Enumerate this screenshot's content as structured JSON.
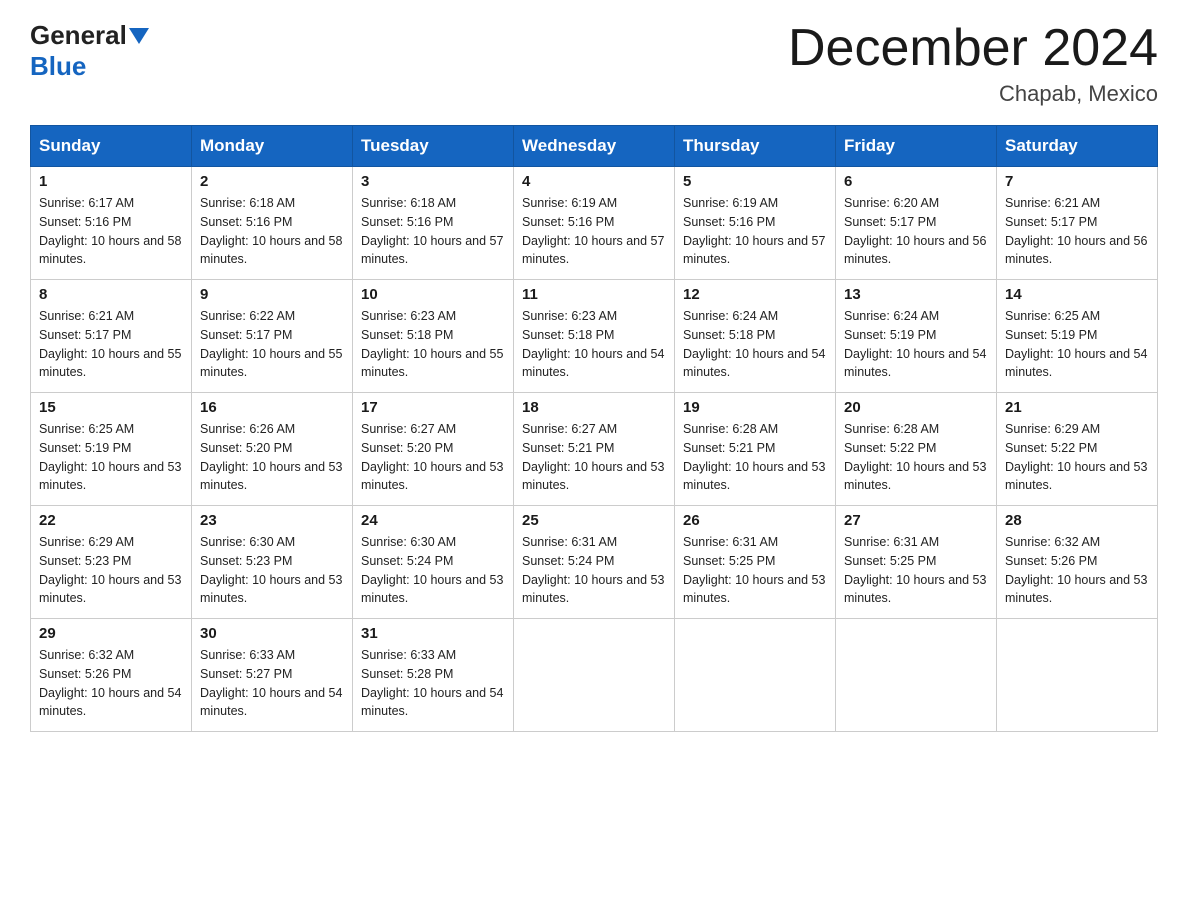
{
  "header": {
    "logo": {
      "text_before": "General",
      "text_after": "Blue"
    },
    "title": "December 2024",
    "location": "Chapab, Mexico"
  },
  "weekdays": [
    "Sunday",
    "Monday",
    "Tuesday",
    "Wednesday",
    "Thursday",
    "Friday",
    "Saturday"
  ],
  "weeks": [
    [
      {
        "day": "1",
        "sunrise": "6:17 AM",
        "sunset": "5:16 PM",
        "daylight": "10 hours and 58 minutes."
      },
      {
        "day": "2",
        "sunrise": "6:18 AM",
        "sunset": "5:16 PM",
        "daylight": "10 hours and 58 minutes."
      },
      {
        "day": "3",
        "sunrise": "6:18 AM",
        "sunset": "5:16 PM",
        "daylight": "10 hours and 57 minutes."
      },
      {
        "day": "4",
        "sunrise": "6:19 AM",
        "sunset": "5:16 PM",
        "daylight": "10 hours and 57 minutes."
      },
      {
        "day": "5",
        "sunrise": "6:19 AM",
        "sunset": "5:16 PM",
        "daylight": "10 hours and 57 minutes."
      },
      {
        "day": "6",
        "sunrise": "6:20 AM",
        "sunset": "5:17 PM",
        "daylight": "10 hours and 56 minutes."
      },
      {
        "day": "7",
        "sunrise": "6:21 AM",
        "sunset": "5:17 PM",
        "daylight": "10 hours and 56 minutes."
      }
    ],
    [
      {
        "day": "8",
        "sunrise": "6:21 AM",
        "sunset": "5:17 PM",
        "daylight": "10 hours and 55 minutes."
      },
      {
        "day": "9",
        "sunrise": "6:22 AM",
        "sunset": "5:17 PM",
        "daylight": "10 hours and 55 minutes."
      },
      {
        "day": "10",
        "sunrise": "6:23 AM",
        "sunset": "5:18 PM",
        "daylight": "10 hours and 55 minutes."
      },
      {
        "day": "11",
        "sunrise": "6:23 AM",
        "sunset": "5:18 PM",
        "daylight": "10 hours and 54 minutes."
      },
      {
        "day": "12",
        "sunrise": "6:24 AM",
        "sunset": "5:18 PM",
        "daylight": "10 hours and 54 minutes."
      },
      {
        "day": "13",
        "sunrise": "6:24 AM",
        "sunset": "5:19 PM",
        "daylight": "10 hours and 54 minutes."
      },
      {
        "day": "14",
        "sunrise": "6:25 AM",
        "sunset": "5:19 PM",
        "daylight": "10 hours and 54 minutes."
      }
    ],
    [
      {
        "day": "15",
        "sunrise": "6:25 AM",
        "sunset": "5:19 PM",
        "daylight": "10 hours and 53 minutes."
      },
      {
        "day": "16",
        "sunrise": "6:26 AM",
        "sunset": "5:20 PM",
        "daylight": "10 hours and 53 minutes."
      },
      {
        "day": "17",
        "sunrise": "6:27 AM",
        "sunset": "5:20 PM",
        "daylight": "10 hours and 53 minutes."
      },
      {
        "day": "18",
        "sunrise": "6:27 AM",
        "sunset": "5:21 PM",
        "daylight": "10 hours and 53 minutes."
      },
      {
        "day": "19",
        "sunrise": "6:28 AM",
        "sunset": "5:21 PM",
        "daylight": "10 hours and 53 minutes."
      },
      {
        "day": "20",
        "sunrise": "6:28 AM",
        "sunset": "5:22 PM",
        "daylight": "10 hours and 53 minutes."
      },
      {
        "day": "21",
        "sunrise": "6:29 AM",
        "sunset": "5:22 PM",
        "daylight": "10 hours and 53 minutes."
      }
    ],
    [
      {
        "day": "22",
        "sunrise": "6:29 AM",
        "sunset": "5:23 PM",
        "daylight": "10 hours and 53 minutes."
      },
      {
        "day": "23",
        "sunrise": "6:30 AM",
        "sunset": "5:23 PM",
        "daylight": "10 hours and 53 minutes."
      },
      {
        "day": "24",
        "sunrise": "6:30 AM",
        "sunset": "5:24 PM",
        "daylight": "10 hours and 53 minutes."
      },
      {
        "day": "25",
        "sunrise": "6:31 AM",
        "sunset": "5:24 PM",
        "daylight": "10 hours and 53 minutes."
      },
      {
        "day": "26",
        "sunrise": "6:31 AM",
        "sunset": "5:25 PM",
        "daylight": "10 hours and 53 minutes."
      },
      {
        "day": "27",
        "sunrise": "6:31 AM",
        "sunset": "5:25 PM",
        "daylight": "10 hours and 53 minutes."
      },
      {
        "day": "28",
        "sunrise": "6:32 AM",
        "sunset": "5:26 PM",
        "daylight": "10 hours and 53 minutes."
      }
    ],
    [
      {
        "day": "29",
        "sunrise": "6:32 AM",
        "sunset": "5:26 PM",
        "daylight": "10 hours and 54 minutes."
      },
      {
        "day": "30",
        "sunrise": "6:33 AM",
        "sunset": "5:27 PM",
        "daylight": "10 hours and 54 minutes."
      },
      {
        "day": "31",
        "sunrise": "6:33 AM",
        "sunset": "5:28 PM",
        "daylight": "10 hours and 54 minutes."
      },
      null,
      null,
      null,
      null
    ]
  ]
}
